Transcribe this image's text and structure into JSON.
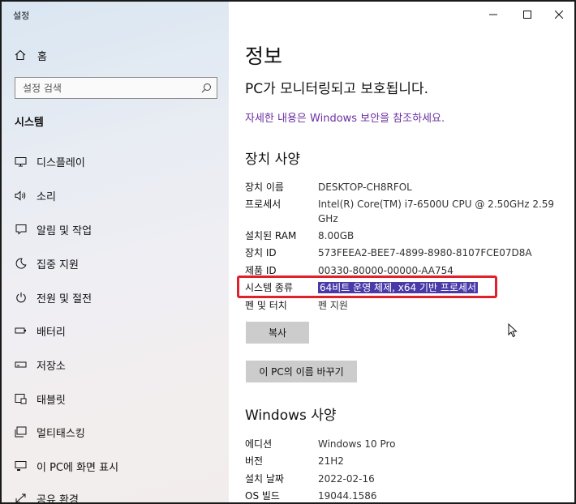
{
  "window": {
    "title": "설정",
    "minimize_icon": "minimize-icon",
    "maximize_icon": "maximize-icon",
    "close_icon": "close-icon"
  },
  "sidebar": {
    "home_label": "홈",
    "search_placeholder": "설정 검색",
    "section_title": "시스템",
    "items": [
      {
        "label": "디스플레이",
        "icon": "monitor-icon"
      },
      {
        "label": "소리",
        "icon": "speaker-icon"
      },
      {
        "label": "알림 및 작업",
        "icon": "notification-icon"
      },
      {
        "label": "집중 지원",
        "icon": "moon-icon"
      },
      {
        "label": "전원 및 절전",
        "icon": "power-icon"
      },
      {
        "label": "배터리",
        "icon": "battery-icon"
      },
      {
        "label": "저장소",
        "icon": "storage-icon"
      },
      {
        "label": "태블릿",
        "icon": "tablet-icon"
      },
      {
        "label": "멀티태스킹",
        "icon": "multitasking-icon"
      },
      {
        "label": "이 PC에 화면 표시",
        "icon": "project-icon"
      },
      {
        "label": "공유 환경",
        "icon": "share-icon"
      }
    ]
  },
  "main": {
    "title": "정보",
    "protected_text": "PC가 모니터링되고 보호됩니다.",
    "security_link": "자세한 내용은 Windows 보안을 참조하세요.",
    "device_specs": {
      "heading": "장치 사양",
      "rows": [
        {
          "label": "장치 이름",
          "value": "DESKTOP-CH8RFOL"
        },
        {
          "label": "프로세서",
          "value": "Intel(R) Core(TM) i7-6500U CPU @ 2.50GHz   2.59 GHz"
        },
        {
          "label": "설치된 RAM",
          "value": "8.00GB"
        },
        {
          "label": "장치 ID",
          "value": "573FEEA2-BEE7-4899-8980-8107FCE07D8A"
        },
        {
          "label": "제품 ID",
          "value": "00330-80000-00000-AA754"
        },
        {
          "label": "시스템 종류",
          "value": "64비트 운영 체제, x64 기반 프로세서"
        },
        {
          "label": "펜 및 터치",
          "value": "펜 지원"
        }
      ],
      "copy_button": "복사",
      "rename_button": "이 PC의 이름 바꾸기"
    },
    "windows_specs": {
      "heading": "Windows 사양",
      "rows": [
        {
          "label": "에디션",
          "value": "Windows 10 Pro"
        },
        {
          "label": "버전",
          "value": "21H2"
        },
        {
          "label": "설치 날짜",
          "value": "2022-02-16"
        },
        {
          "label": "OS 빌드",
          "value": "19044.1586"
        }
      ]
    }
  },
  "colors": {
    "link": "#6b2fa3",
    "highlight_bg": "#4a3aa8",
    "annotation_box": "#e0202a",
    "button_bg": "#cccccc"
  }
}
